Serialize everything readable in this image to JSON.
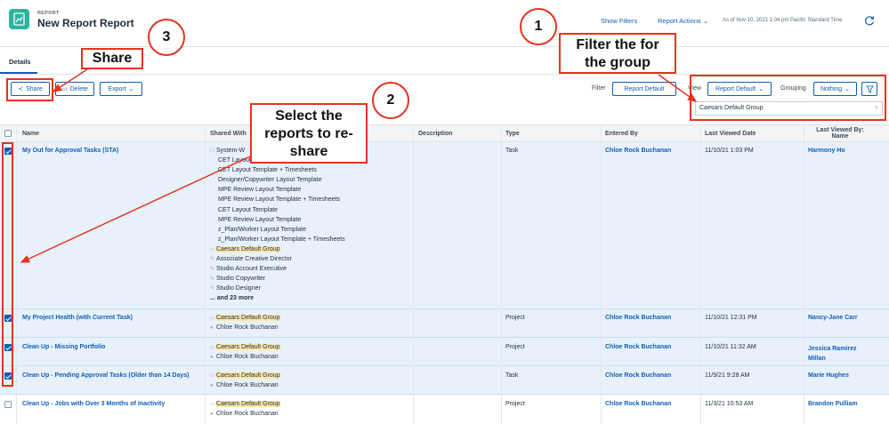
{
  "header": {
    "kicker": "REPORT",
    "title": "New Report Report",
    "show_filters": "Show Filters",
    "report_actions": "Report Actions",
    "as_of": "As of Nov 10, 2021 1:04 pm Pacific Standard Time"
  },
  "tabs": {
    "details": "Details"
  },
  "toolbar": {
    "share": "Share",
    "delete": "Delete",
    "export": "Export",
    "filter_label": "Filter",
    "filter_value": "Report Default",
    "view_label": "View",
    "view_value": "Report Default",
    "grouping_label": "Grouping",
    "grouping_value": "Nothing",
    "search_value": "Caesars Default Group"
  },
  "columns": {
    "name": "Name",
    "shared_with": "Shared With",
    "description": "Description",
    "type": "Type",
    "entered_by": "Entered By",
    "last_viewed_date": "Last Viewed Date",
    "last_viewed_by_1": "Last Viewed By:",
    "last_viewed_by_2": "Name"
  },
  "rows": [
    {
      "name": "My Out for Approval Tasks (STA)",
      "shared": [
        "System-W",
        "CET Layout",
        "CET Layout Template + Timesheets",
        "Designer/Copywriter Layout Template",
        "MPE Review Layout Template",
        "MPE Review Layout Template + Timesheets",
        "CET Layout Template",
        "MPE Review Layout Template",
        "z_Plan/Worker Layout Template",
        "z_Plan/Worker Layout Template + Timesheets",
        "Caesars Default Group",
        "Associate Creative Director",
        "Studio Account Executive",
        "Studio Copywriter",
        "Studio Designer"
      ],
      "more": "... and 23 more",
      "type": "Task",
      "entered_by": "Chloe Rock Buchanan",
      "date": "11/10/21 1:03 PM",
      "viewer": "Harmony Ho"
    },
    {
      "name": "My Project Health (with Current Task)",
      "shared": [
        "Caesars Default Group",
        "Chloe Rock Buchanan"
      ],
      "type": "Project",
      "entered_by": "Chloe Rock Buchanan",
      "date": "11/10/21 12:31 PM",
      "viewer": "Nancy-Jane Carr"
    },
    {
      "name": "Clean Up - Missing Portfolio",
      "shared": [
        "Caesars Default Group",
        "Chloe Rock Buchanan"
      ],
      "type": "Project",
      "entered_by": "Chloe Rock Buchanan",
      "date": "11/10/21 11:32 AM",
      "viewer_1": "Jessica Ramirez",
      "viewer_2": "Millan"
    },
    {
      "name": "Clean Up - Pending Approval Tasks (Older than 14 Days)",
      "shared": [
        "Caesars Default Group",
        "Chloe Rock Buchanan"
      ],
      "type": "Task",
      "entered_by": "Chloe Rock Buchanan",
      "date": "11/9/21 9:28 AM",
      "viewer": "Marie Hughes"
    },
    {
      "name": "Clean Up - Jobs with Over 3 Months of Inactivity",
      "shared": [
        "Caesars Default Group",
        "Chloe Rock Buchanan"
      ],
      "type": "Project",
      "entered_by": "Chloe Rock Buchanan",
      "date": "11/3/21 10:53 AM",
      "viewer": "Brandon Pulliam"
    }
  ],
  "annotations": {
    "n1": "1",
    "n2": "2",
    "n3": "3",
    "filter_line1": "Filter the for",
    "filter_line2": "the group",
    "select_line1": "Select the",
    "select_line2": "reports to re-",
    "select_line3": "share",
    "share": "Share"
  },
  "colors": {
    "accent": "#0f5fb6",
    "brand": "#2bb5a0",
    "annotation": "#e53320",
    "highlight": "#fbe7a8",
    "selected_row": "#e8f1fa"
  }
}
